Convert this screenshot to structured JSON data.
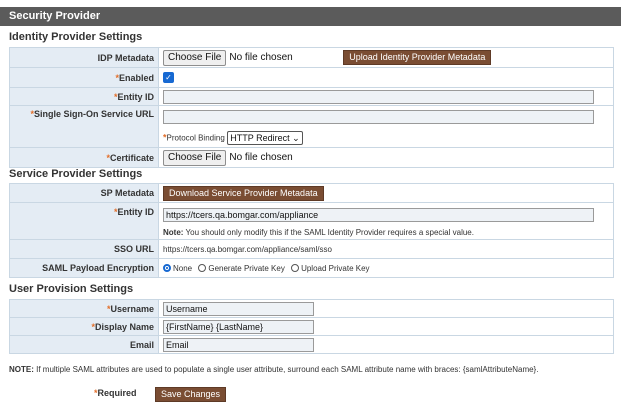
{
  "window": {
    "title": "Security Provider"
  },
  "idp": {
    "section_title": "Identity Provider Settings",
    "metadata_label": "IDP Metadata",
    "choose_file": "Choose File",
    "no_file": "No file chosen",
    "upload_button": "Upload Identity Provider Metadata",
    "enabled_label": "Enabled",
    "entity_id_label": "Entity ID",
    "entity_id_value": "",
    "sso_url_label": "Single Sign-On Service URL",
    "sso_url_value": "",
    "protocol_binding_label": "Protocol Binding",
    "protocol_binding_value": "HTTP Redirect",
    "certificate_label": "Certificate",
    "cert_choose_file": "Choose File",
    "cert_no_file": "No file chosen"
  },
  "sp": {
    "section_title": "Service Provider Settings",
    "metadata_label": "SP Metadata",
    "download_button": "Download Service Provider Metadata",
    "entity_id_label": "Entity ID",
    "entity_id_value": "https://tcers.qa.bomgar.com/appliance",
    "entity_note_prefix": "Note:",
    "entity_note_text": " You should only modify this if the SAML Identity Provider requires a special value.",
    "sso_url_label": "SSO URL",
    "sso_url_value": "https://tcers.qa.bomgar.com/appliance/saml/sso",
    "encryption_label": "SAML Payload Encryption",
    "enc_none": "None",
    "enc_generate": "Generate Private Key",
    "enc_upload": "Upload Private Key"
  },
  "provision": {
    "section_title": "User Provision Settings",
    "username_label": "Username",
    "username_value": "Username",
    "display_name_label": "Display Name",
    "display_name_value": "{FirstName} {LastName}",
    "email_label": "Email",
    "email_value": "Email"
  },
  "footer": {
    "note_prefix": "NOTE:",
    "note_text": " If multiple SAML attributes are used to populate a single user attribute, surround each SAML attribute name with braces: {samlAttributeName}.",
    "required_label": "Required",
    "save_button": "Save Changes"
  },
  "colors": {
    "required": "#e36f2a",
    "button": "#7a4d33",
    "label_bg": "#e4ecf4",
    "titlebar": "#5b5b5b"
  }
}
